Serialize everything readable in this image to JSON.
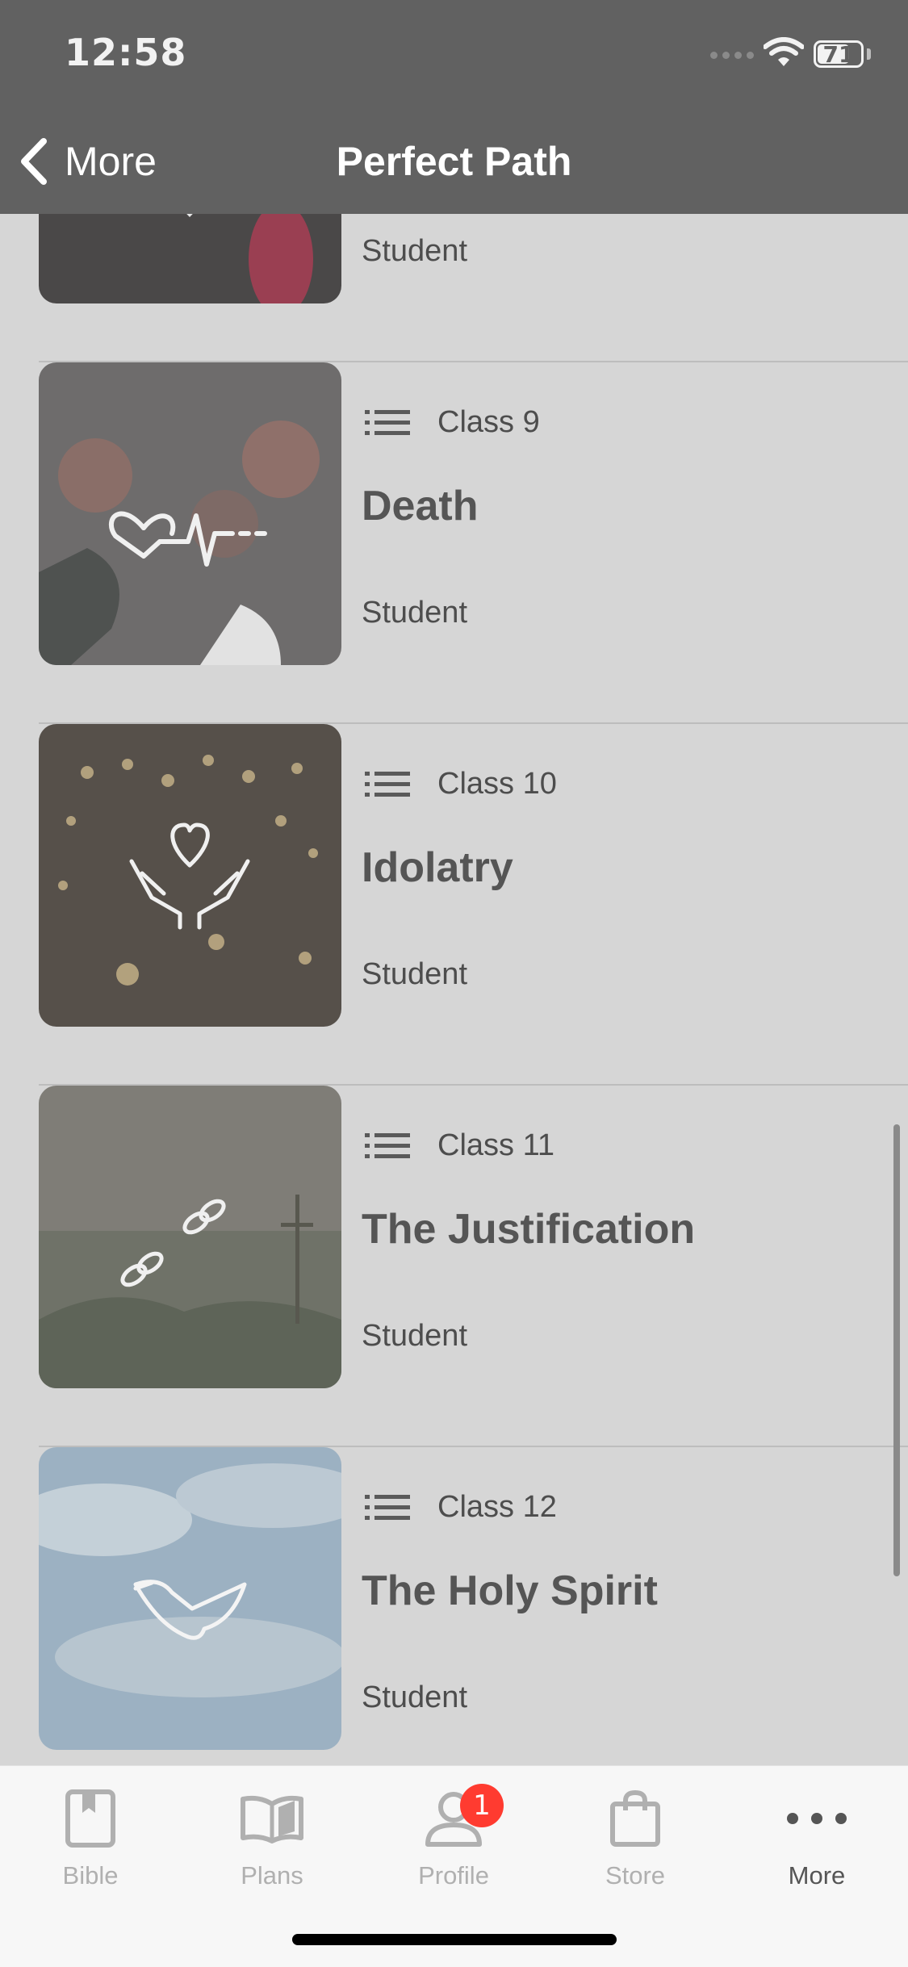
{
  "status_bar": {
    "time": "12:58",
    "battery_level": "71",
    "icons": [
      "signal-icon",
      "wifi-icon",
      "battery-icon"
    ]
  },
  "nav": {
    "back_label": "More",
    "title": "Perfect Path"
  },
  "rows": [
    {
      "class_label": "",
      "title": "",
      "subtitle": "Student",
      "icon": "partial-thumbnail"
    },
    {
      "class_label": "Class 9",
      "title": "Death",
      "subtitle": "Student",
      "icon": "heartbeat-icon"
    },
    {
      "class_label": "Class 10",
      "title": "Idolatry",
      "subtitle": "Student",
      "icon": "hands-heart-icon"
    },
    {
      "class_label": "Class 11",
      "title": "The Justification",
      "subtitle": "Student",
      "icon": "broken-chain-icon"
    },
    {
      "class_label": "Class 12",
      "title": "The Holy Spirit",
      "subtitle": "Student",
      "icon": "dove-icon"
    }
  ],
  "tabs": [
    {
      "label": "Bible",
      "icon": "bible-icon",
      "active": false
    },
    {
      "label": "Plans",
      "icon": "plans-book-icon",
      "active": false
    },
    {
      "label": "Profile",
      "icon": "profile-icon",
      "active": false,
      "badge": "1"
    },
    {
      "label": "Store",
      "icon": "store-bag-icon",
      "active": false
    },
    {
      "label": "More",
      "icon": "more-dots-icon",
      "active": true
    }
  ],
  "colors": {
    "nav_bg": "#616161",
    "list_bg": "#d6d6d6",
    "tab_bg": "#f7f7f7",
    "badge": "#ff3b30",
    "tab_inactive": "#b0b0b0",
    "tab_active": "#555555"
  }
}
